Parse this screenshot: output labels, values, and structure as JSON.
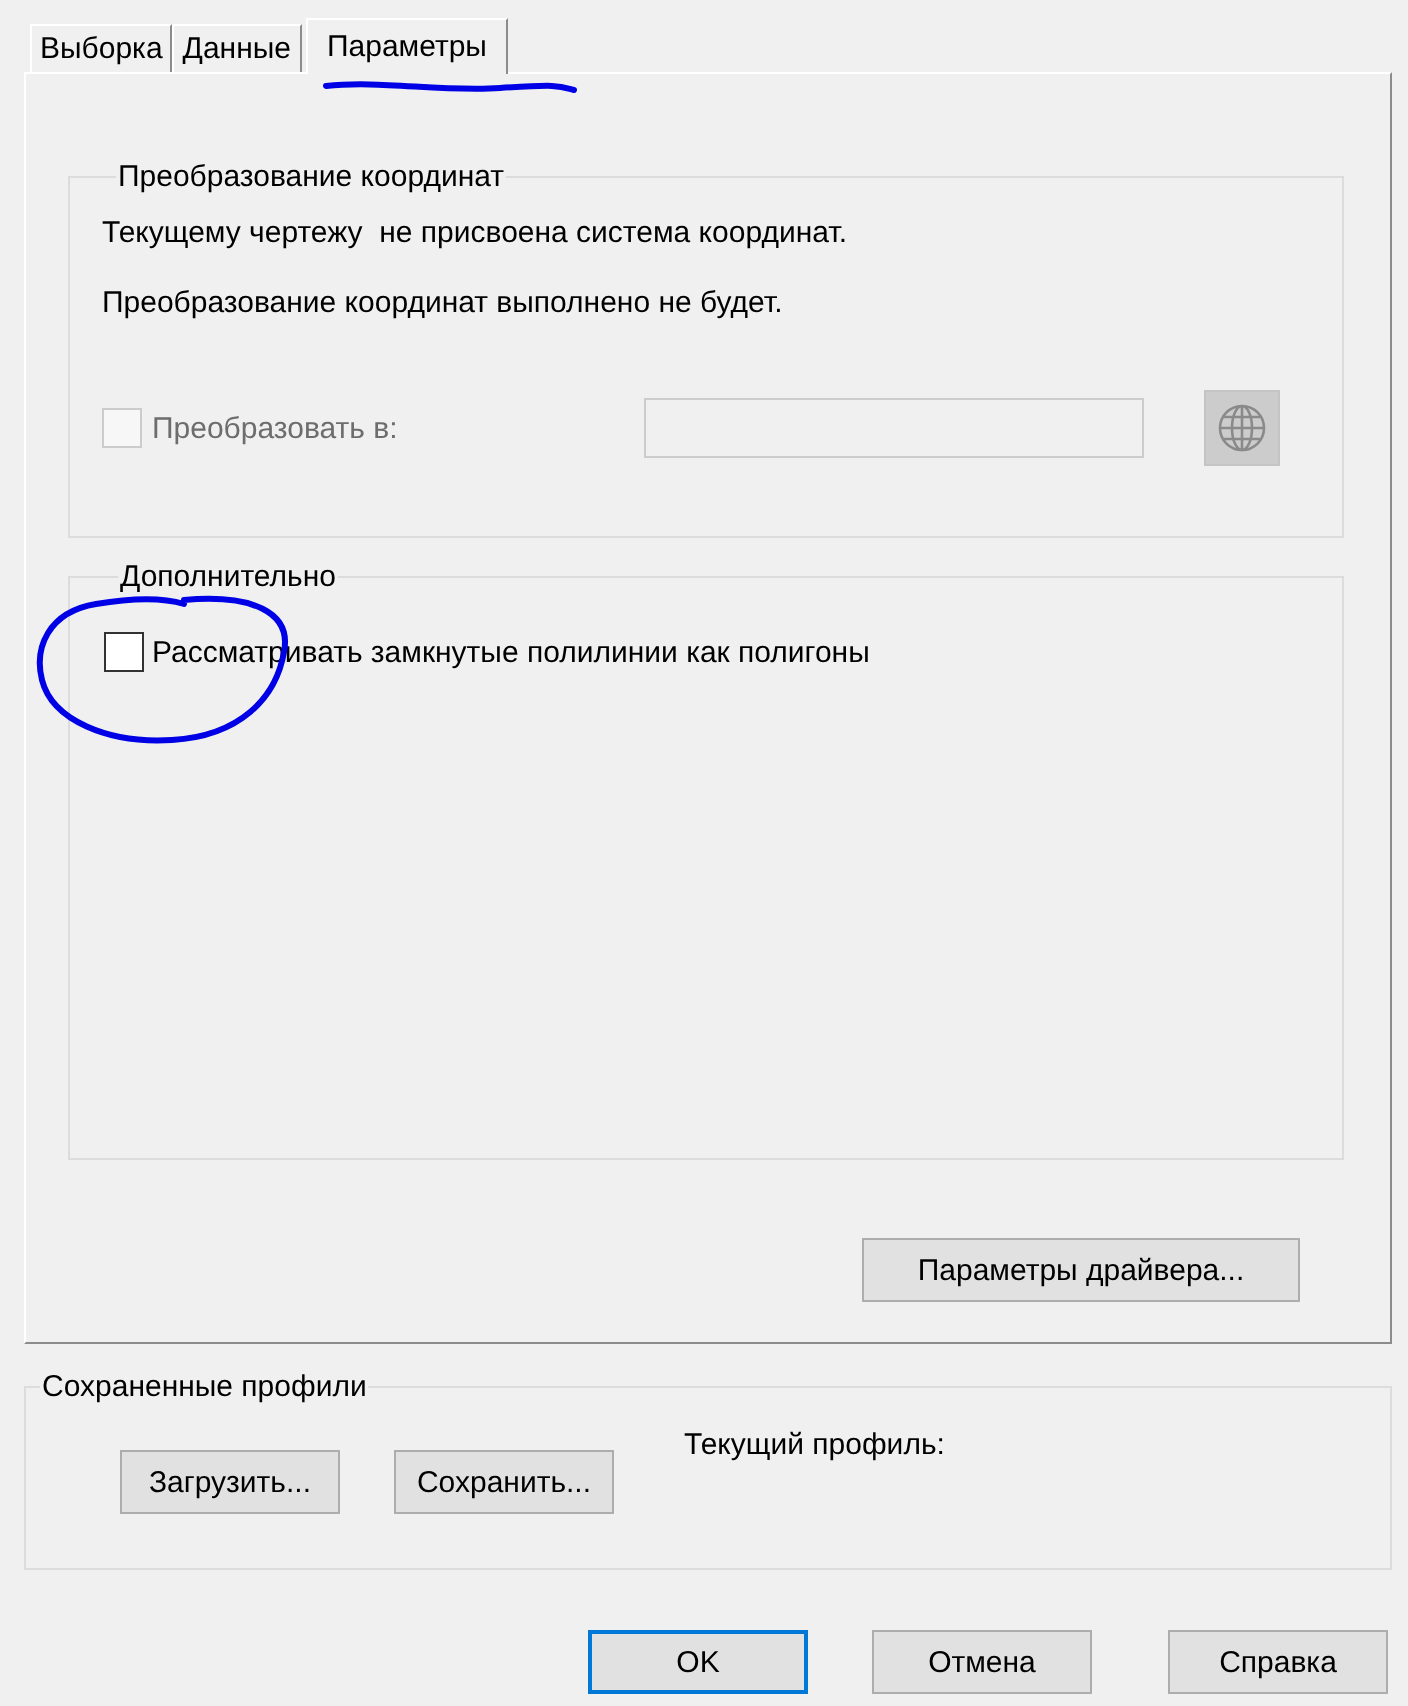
{
  "tabs": [
    {
      "label": "Выборка",
      "selected": false
    },
    {
      "label": "Данные",
      "selected": false
    },
    {
      "label": "Параметры",
      "selected": true
    }
  ],
  "coordinate_transform": {
    "title": "Преобразование координат",
    "messages": [
      "Текущему чертежу  не присвоена система координат.",
      "Преобразование координат выполнено не будет."
    ],
    "convert": {
      "label": "Преобразовать в:",
      "checked": false,
      "disabled": true
    },
    "target_field": {
      "disabled": true
    },
    "globe_button": {
      "disabled": true
    }
  },
  "advanced": {
    "title": "Дополнительно",
    "options": [
      {
        "label": "Рассматривать замкнутые полилинии как полигоны",
        "checked": false
      }
    ]
  },
  "driver_button": {
    "label": "Параметры драйвера..."
  },
  "profiles": {
    "title": "Сохраненные профили",
    "buttons": [
      {
        "label": "Загрузить..."
      },
      {
        "label": "Сохранить..."
      }
    ],
    "current_label": "Текущий профиль:"
  },
  "dialog_buttons": [
    {
      "label": "OK",
      "default": true
    },
    {
      "label": "Отмена",
      "default": false
    },
    {
      "label": "Справка",
      "default": false
    }
  ]
}
